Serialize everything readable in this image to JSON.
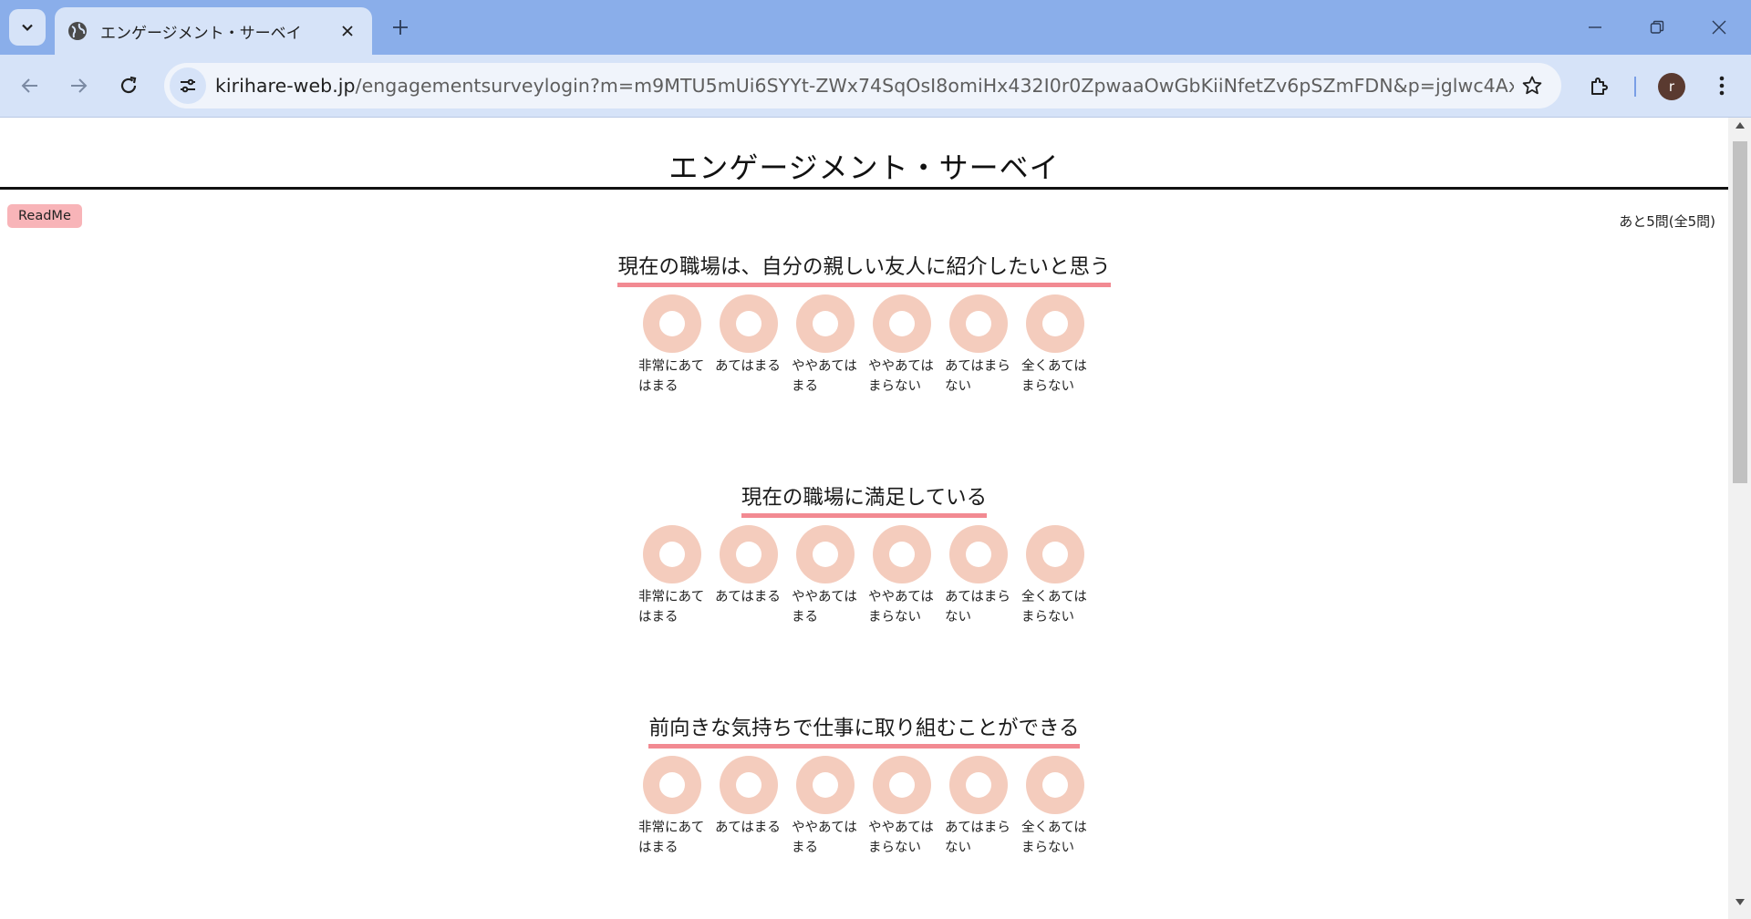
{
  "browser": {
    "tab_title": "エンゲージメント・サーベイ",
    "url_host": "kirihare-web.jp",
    "url_path": "/engagementsurveylogin?m=m9MTU5mUi6SYYt-ZWx74SqOsI8omiHx432I0r0ZpwaaOwGbKiiNfetZv6pSZmFDN&p=jglwc4AxEtRuSLpSje...",
    "profile_initial": "r"
  },
  "page": {
    "title": "エンゲージメント・サーベイ",
    "readme_label": "ReadMe",
    "remaining_text": "あと5問(全5問)"
  },
  "questions": [
    {
      "text": "現在の職場は、自分の親しい友人に紹介したいと思う",
      "choices": [
        "非常にあてはまる",
        "あてはまる",
        "ややあてはまる",
        "ややあてはまらない",
        "あてはまらない",
        "全くあてはまらない"
      ]
    },
    {
      "text": "現在の職場に満足している",
      "choices": [
        "非常にあてはまる",
        "あてはまる",
        "ややあてはまる",
        "ややあてはまらない",
        "あてはまらない",
        "全くあてはまらない"
      ]
    },
    {
      "text": "前向きな気持ちで仕事に取り組むことができる",
      "choices": [
        "非常にあてはまる",
        "あてはまる",
        "ややあてはまる",
        "ややあてはまらない",
        "あてはまらない",
        "全くあてはまらない"
      ]
    }
  ],
  "colors": {
    "underline": "#f28a92",
    "radio_ring": "#f4ccbd",
    "readme_bg": "#f8b4b8"
  }
}
